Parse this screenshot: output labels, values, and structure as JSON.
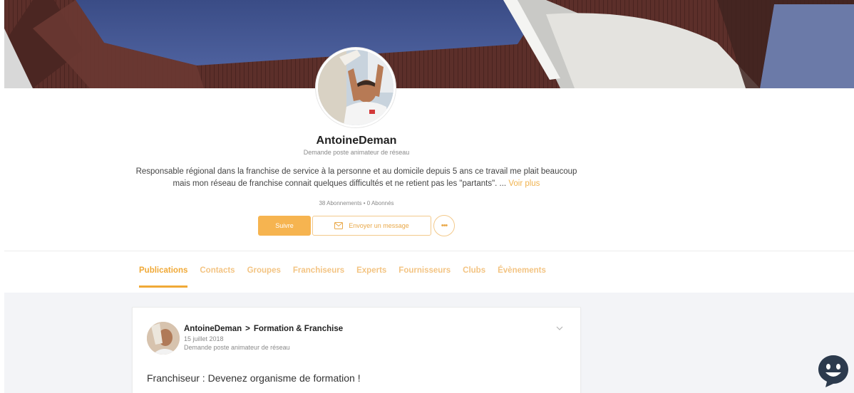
{
  "profile": {
    "name": "AntoineDeman",
    "subtitle": "Demande poste animateur de réseau",
    "bio": "Responsable régional dans la franchise de service à la personne et au domicile depuis 5 ans ce travail me plait beaucoup mais mon réseau de franchise connait quelques difficultés et ne retient pas les \"partants\". ...",
    "bio_more": "Voir plus",
    "stats": "38 Abonnements • 0 Abonnés"
  },
  "actions": {
    "follow_label": "Suivre",
    "message_label": "Envoyer un message",
    "more_label": "•••"
  },
  "tabs": [
    {
      "label": "Publications",
      "active": true
    },
    {
      "label": "Contacts",
      "active": false
    },
    {
      "label": "Groupes",
      "active": false
    },
    {
      "label": "Franchiseurs",
      "active": false
    },
    {
      "label": "Experts",
      "active": false
    },
    {
      "label": "Fournisseurs",
      "active": false
    },
    {
      "label": "Clubs",
      "active": false
    },
    {
      "label": "Évènements",
      "active": false
    }
  ],
  "post": {
    "author": "AntoineDeman",
    "separator": ">",
    "group": "Formation & Franchise",
    "date": "15 juillet 2018",
    "role": "Demande poste animateur de réseau",
    "title": "Franchiseur : Devenez organisme de formation !"
  },
  "icons": {
    "message": "envelope-icon",
    "more": "ellipsis-icon",
    "post_menu": "chevron-down-icon",
    "chat": "chat-bubble-icon"
  },
  "colors": {
    "accent": "#f0a937",
    "follow_button": "#f6b450",
    "chat": "#2c3a4d"
  }
}
